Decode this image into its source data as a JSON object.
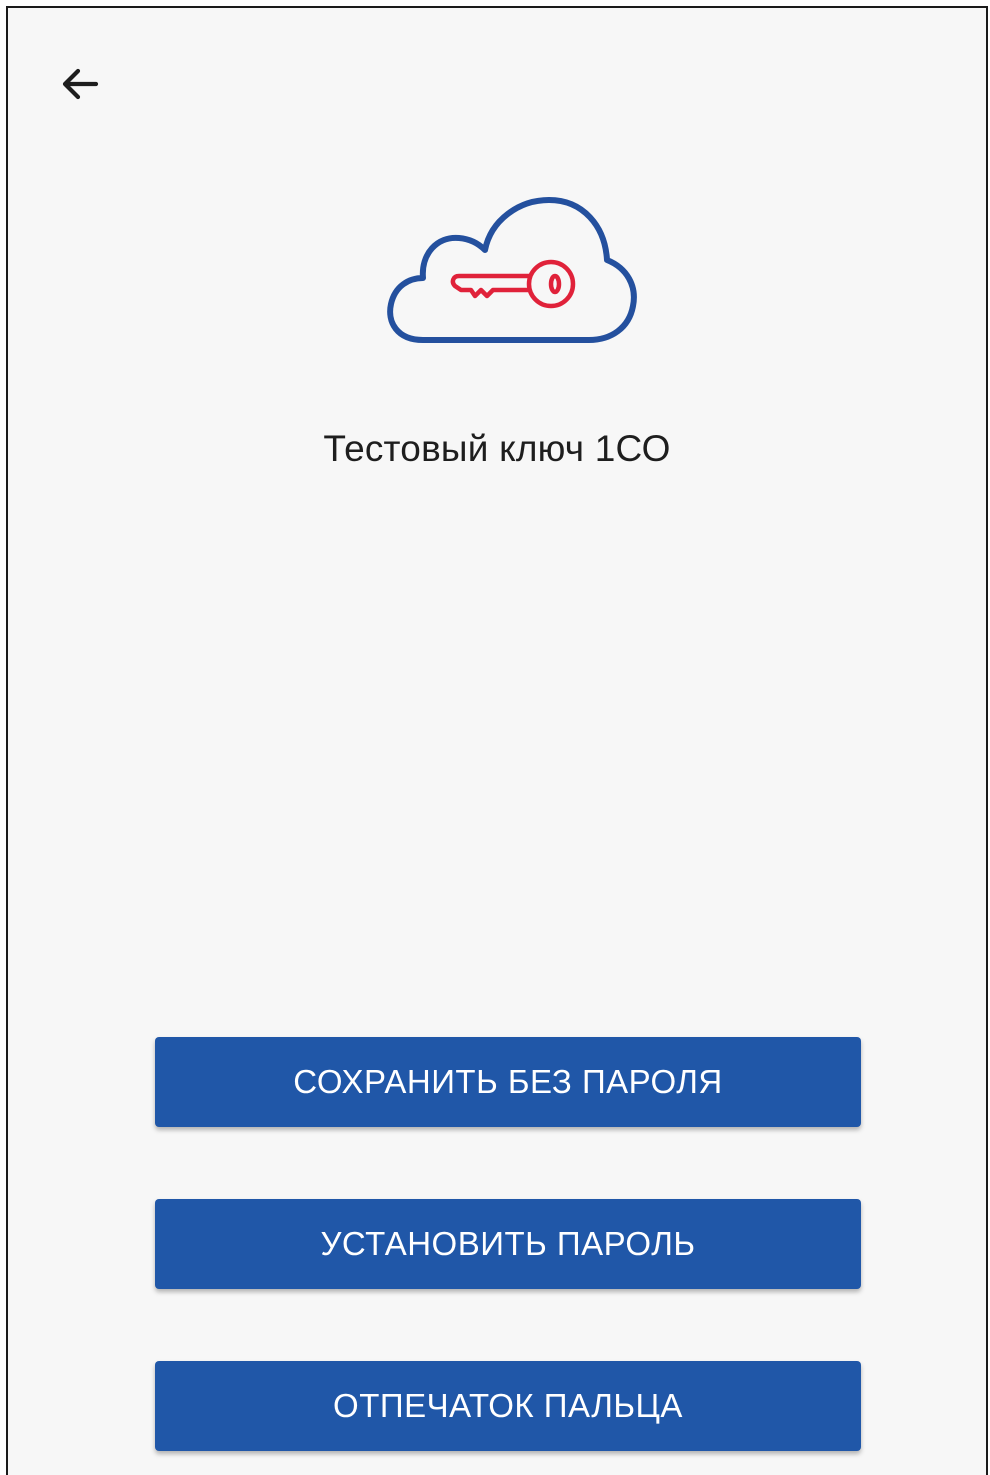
{
  "header": {
    "back_icon": "arrow-left-icon"
  },
  "logo": {
    "icon": "cloud-key-icon",
    "cloud_color": "#24509e",
    "key_color": "#e0223a"
  },
  "key": {
    "title": "Тестовый ключ 1СО"
  },
  "actions": {
    "save_without_password": "СОХРАНИТЬ БЕЗ ПАРОЛЯ",
    "set_password": "УСТАНОВИТЬ ПАРОЛЬ",
    "fingerprint": "ОТПЕЧАТОК ПАЛЬЦА"
  },
  "colors": {
    "button_bg": "#2057a8",
    "button_text": "#ffffff",
    "background": "#f7f7f7"
  }
}
